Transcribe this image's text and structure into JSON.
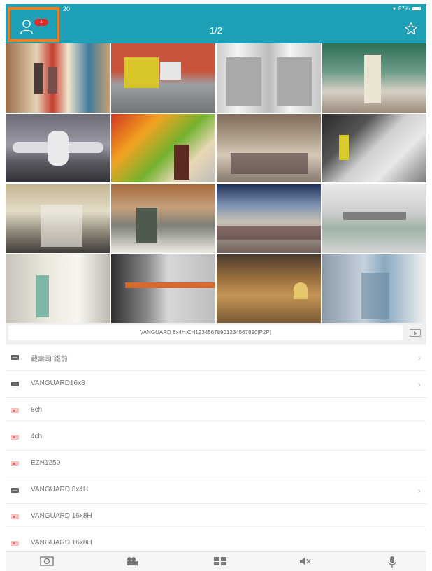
{
  "status_bar": {
    "time": "20",
    "battery": "87%"
  },
  "header": {
    "notification_count": "1",
    "page_indicator": "1/2"
  },
  "camera_grid": [
    {
      "id": "cam-1",
      "scene": "supermarket-aisle"
    },
    {
      "id": "cam-2",
      "scene": "street-bus"
    },
    {
      "id": "cam-3",
      "scene": "elevator-doors"
    },
    {
      "id": "cam-4",
      "scene": "shopping-arcade"
    },
    {
      "id": "cam-5",
      "scene": "airport-plane"
    },
    {
      "id": "cam-6",
      "scene": "fruit-market"
    },
    {
      "id": "cam-7",
      "scene": "pedestrian-street"
    },
    {
      "id": "cam-8",
      "scene": "escalators"
    },
    {
      "id": "cam-9",
      "scene": "mall-atrium"
    },
    {
      "id": "cam-10",
      "scene": "lobby-escalator"
    },
    {
      "id": "cam-11",
      "scene": "station-hall"
    },
    {
      "id": "cam-12",
      "scene": "mall-interior"
    },
    {
      "id": "cam-13",
      "scene": "hospital-corridor"
    },
    {
      "id": "cam-14",
      "scene": "subway-train"
    },
    {
      "id": "cam-15",
      "scene": "library-reading-room"
    },
    {
      "id": "cam-16",
      "scene": "glass-entrance"
    }
  ],
  "device_bar": {
    "current_device": "VANGUARD 8x4H:CH12345678901234567890[P2P]"
  },
  "device_list": [
    {
      "label": "藏壽司 鐵前",
      "icon": "dvr-icon",
      "has_chevron": true
    },
    {
      "label": "VANGUARD16x8",
      "icon": "dvr-icon",
      "has_chevron": true
    },
    {
      "label": "8ch",
      "icon": "camera-icon",
      "has_chevron": false
    },
    {
      "label": "4ch",
      "icon": "camera-icon",
      "has_chevron": false
    },
    {
      "label": "EZN1250",
      "icon": "camera-icon",
      "has_chevron": false
    },
    {
      "label": "VANGUARD 8x4H",
      "icon": "dvr-icon",
      "has_chevron": true
    },
    {
      "label": "VANGUARD 16x8H",
      "icon": "camera-icon",
      "has_chevron": false
    },
    {
      "label": "VANGUARD 16x8H",
      "icon": "camera-icon",
      "has_chevron": false
    }
  ],
  "toolbar": [
    {
      "name": "snapshot-icon"
    },
    {
      "name": "record-icon"
    },
    {
      "name": "layout-grid-icon"
    },
    {
      "name": "mute-icon"
    },
    {
      "name": "microphone-icon"
    }
  ],
  "colors": {
    "header": "#1ea1b6",
    "highlight": "#ef7d22",
    "badge": "#e52b2b"
  }
}
